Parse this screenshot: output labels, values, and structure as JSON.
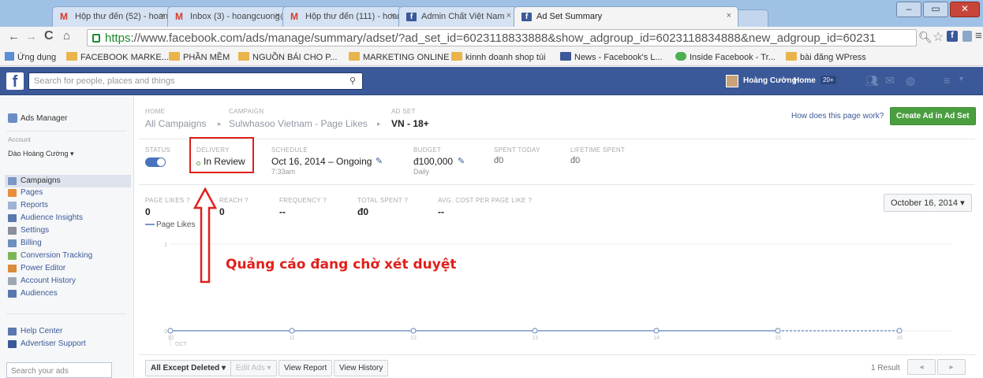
{
  "browser": {
    "tabs": [
      {
        "label": "Hộp thư đến (52) - hoang"
      },
      {
        "label": "Inbox (3) - hoangcuong@"
      },
      {
        "label": "Hộp thư đến (111) - hoan"
      },
      {
        "label": "Admin Chất Việt Nam"
      },
      {
        "label": "Ad Set Summary"
      }
    ],
    "url_scheme": "https",
    "url_rest": "://www.facebook.com/ads/manage/summary/adset/?ad_set_id=6023118833888&show_adgroup_id=6023118834888&new_adgroup_id=60231",
    "bookmarks": [
      {
        "label": "Ứng dụng"
      },
      {
        "label": "FACEBOOK MARKE..."
      },
      {
        "label": "PHẦN MỀM"
      },
      {
        "label": "NGUỒN BÁI CHO P..."
      },
      {
        "label": "MARKETING ONLINE"
      },
      {
        "label": "kinnh doanh shop túi"
      },
      {
        "label": "News - Facebook's L..."
      },
      {
        "label": "Inside Facebook - Tr..."
      },
      {
        "label": "bài đăng WPress"
      }
    ]
  },
  "fb_header": {
    "search_placeholder": "Search for people, places and things",
    "user_name": "Hoàng Cường",
    "home_label": "Home",
    "home_badge": "20+"
  },
  "sidebar": {
    "title": "Ads Manager",
    "account_label": "Account",
    "account_name": "Dào Hoàng Cường",
    "items": [
      {
        "label": "Campaigns"
      },
      {
        "label": "Pages"
      },
      {
        "label": "Reports"
      },
      {
        "label": "Audience Insights"
      },
      {
        "label": "Settings"
      },
      {
        "label": "Billing"
      },
      {
        "label": "Conversion Tracking"
      },
      {
        "label": "Power Editor"
      },
      {
        "label": "Account History"
      },
      {
        "label": "Audiences"
      }
    ],
    "help_items": [
      {
        "label": "Help Center"
      },
      {
        "label": "Advertiser Support"
      }
    ],
    "search_placeholder": "Search your ads"
  },
  "breadcrumb": {
    "home_label": "HOME",
    "home_value": "All Campaigns",
    "campaign_label": "CAMPAIGN",
    "campaign_value": "Sulwhasoo Vietnam - Page Likes",
    "adset_label": "AD SET",
    "adset_value": "VN - 18+"
  },
  "top_actions": {
    "help_link": "How does this page work?",
    "create_button": "Create Ad in Ad Set"
  },
  "summary": {
    "status_label": "STATUS",
    "delivery_label": "DELIVERY",
    "delivery_value": "In Review",
    "schedule_label": "SCHEDULE",
    "schedule_value": "Oct 16, 2014 – Ongoing",
    "schedule_time": "7:33am",
    "budget_label": "BUDGET",
    "budget_value": "đ100,000",
    "budget_period": "Daily",
    "spent_today_label": "SPENT TODAY",
    "spent_today_value": "đ0",
    "lifetime_label": "LIFETIME SPENT",
    "lifetime_value": "đ0"
  },
  "metrics": {
    "page_likes_label": "PAGE LIKES ?",
    "page_likes_value": "0",
    "reach_label": "REACH ?",
    "reach_value": "0",
    "frequency_label": "FREQUENCY ?",
    "frequency_value": "--",
    "total_spent_label": "TOTAL SPENT ?",
    "total_spent_value": "đ0",
    "avg_cost_label": "AVG. COST PER PAGE LIKE ?",
    "avg_cost_value": "--",
    "date_selector": "October 16, 2014"
  },
  "annotation": {
    "text": "Quảng cáo đang chờ xét duyệt",
    "color": "#e0201b"
  },
  "chart_data": {
    "type": "line",
    "legend": "Page Likes",
    "y_tick_top": "1",
    "y_tick_bottom": "0",
    "x_month": "OCT",
    "x": [
      "10",
      "11",
      "12",
      "13",
      "14",
      "15",
      "16"
    ],
    "values": [
      0,
      0,
      0,
      0,
      0,
      0,
      0
    ],
    "ylim": [
      0,
      1
    ]
  },
  "bottom": {
    "filter_button": "All Except Deleted",
    "edit_ads_button": "Edit Ads",
    "view_report_button": "View Report",
    "view_history_button": "View History",
    "results": "1 Result"
  },
  "colors": {
    "fb_blue": "#3b5998",
    "create_green": "#4a9e3f",
    "chart_line": "#7a97c6"
  }
}
